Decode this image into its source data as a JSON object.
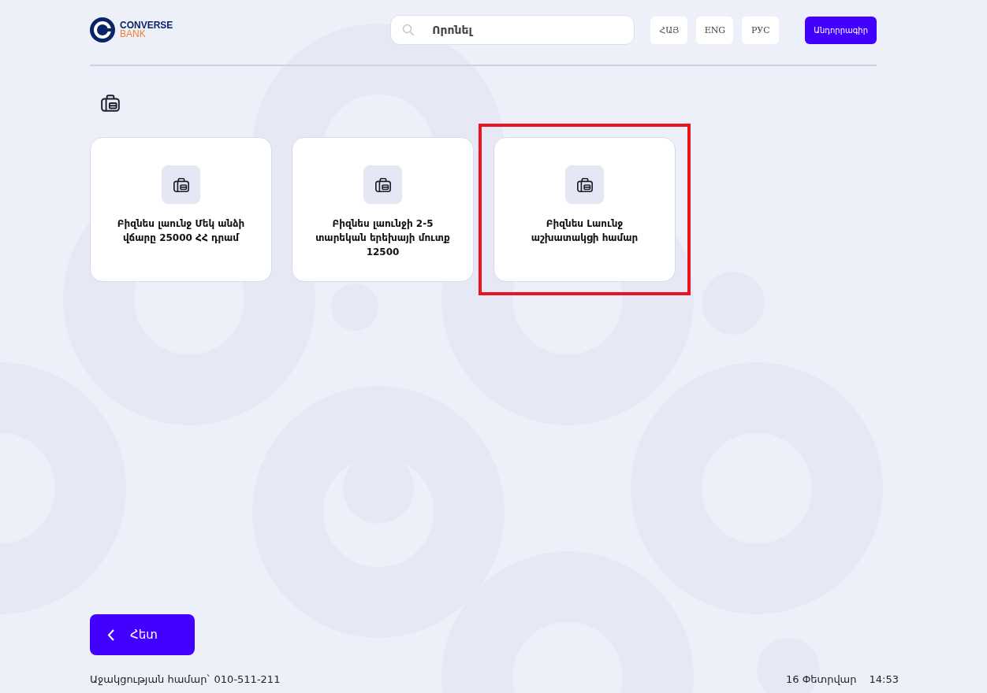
{
  "header": {
    "logo": {
      "name": "CONVERSE",
      "subname": "BANK"
    },
    "search": {
      "placeholder": "Որոնել"
    },
    "languages": [
      "ՀԱՅ",
      "ENG",
      "РУС"
    ],
    "action_button": "Անդորրագիր"
  },
  "cards": [
    {
      "title": "Բիզնես լաունջ Մեկ անձի վճարը 25000 ՀՀ դրամ",
      "highlighted": false
    },
    {
      "title": "Բիզնես լաունջի 2-5 տարեկան երեխայի մուտք 12500",
      "highlighted": false
    },
    {
      "title": "Բիզնես Լաունջ աշխատակցի համար",
      "highlighted": true
    }
  ],
  "back_button": {
    "label": "Հետ"
  },
  "footer": {
    "support_label": "Աջակցության համար՝",
    "support_phone": "010-511-211",
    "date": "16 Փետրվար",
    "time": "14:53"
  }
}
